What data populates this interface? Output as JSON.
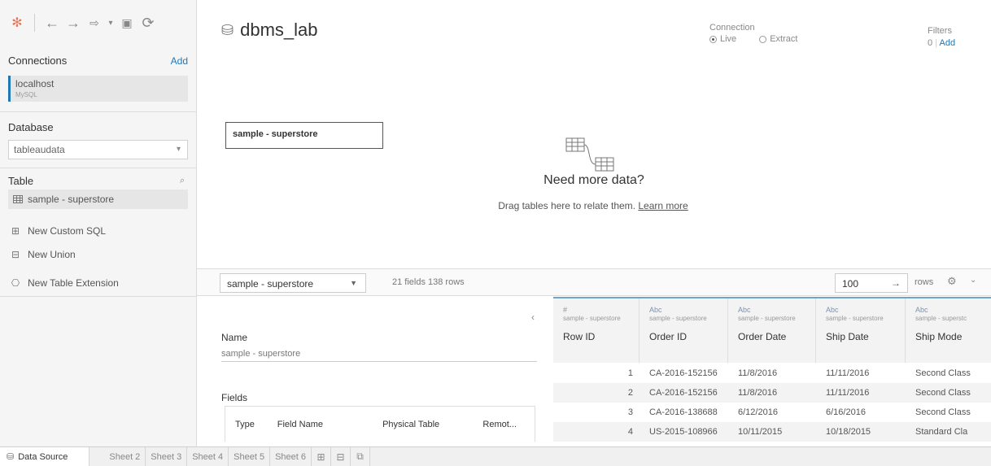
{
  "datasource": {
    "title": "dbms_lab"
  },
  "connection": {
    "label": "Connection",
    "live": "Live",
    "extract": "Extract",
    "selected": "live"
  },
  "filters": {
    "label": "Filters",
    "count": "0",
    "add": "Add"
  },
  "left": {
    "connections_label": "Connections",
    "add_label": "Add",
    "connection_name": "localhost",
    "connection_type": "MySQL",
    "database_label": "Database",
    "database_value": "tableaudata",
    "table_label": "Table",
    "table_item": "sample - superstore",
    "new_custom_sql": "New Custom SQL",
    "new_union": "New Union",
    "new_table_extension": "New Table Extension"
  },
  "canvas": {
    "table_box": "sample - superstore",
    "need_more": "Need more data?",
    "drag_text": "Drag tables here to relate them.",
    "learn_more": "Learn more"
  },
  "bar": {
    "table_select": "sample - superstore",
    "fields_info": "21 fields 138 rows",
    "rows_value": "100",
    "rows_label": "rows"
  },
  "meta": {
    "name_label": "Name",
    "name_value": "sample - superstore",
    "fields_label": "Fields",
    "columns": [
      "Type",
      "Field Name",
      "Physical Table",
      "Remot..."
    ]
  },
  "grid": {
    "columns": [
      {
        "type": "#",
        "source": "sample - superstore",
        "name": "Row ID"
      },
      {
        "type": "Abc",
        "source": "sample - superstore",
        "name": "Order ID"
      },
      {
        "type": "Abc",
        "source": "sample - superstore",
        "name": "Order Date"
      },
      {
        "type": "Abc",
        "source": "sample - superstore",
        "name": "Ship Date"
      },
      {
        "type": "Abc",
        "source": "sample - superstc",
        "name": "Ship Mode"
      }
    ],
    "rows": [
      [
        "1",
        "CA-2016-152156",
        "11/8/2016",
        "11/11/2016",
        "Second Class"
      ],
      [
        "2",
        "CA-2016-152156",
        "11/8/2016",
        "11/11/2016",
        "Second Class"
      ],
      [
        "3",
        "CA-2016-138688",
        "6/12/2016",
        "6/16/2016",
        "Second Class"
      ],
      [
        "4",
        "US-2015-108966",
        "10/11/2015",
        "10/18/2015",
        "Standard Cla"
      ]
    ]
  },
  "tabs": {
    "data_source": "Data Source",
    "sheets": [
      "Sheet 2",
      "Sheet 3",
      "Sheet 4",
      "Sheet 5",
      "Sheet 6"
    ]
  },
  "colors": {
    "accent": "#1f77b4",
    "grid_top": "#6fa3c9"
  }
}
